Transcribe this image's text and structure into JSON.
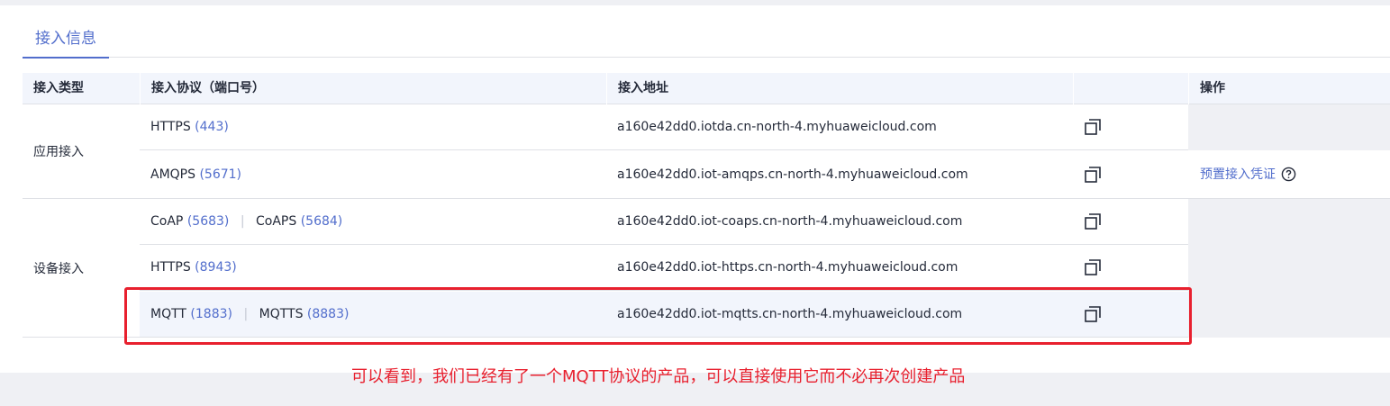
{
  "tabs": [
    {
      "label": "接入信息"
    }
  ],
  "table": {
    "headers": {
      "type": "接入类型",
      "protocol": "接入协议（端口号）",
      "address": "接入地址",
      "copy": "",
      "actions": "操作"
    },
    "groups": [
      {
        "label": "应用接入"
      },
      {
        "label": "设备接入"
      }
    ],
    "rows": [
      {
        "p1": "HTTPS",
        "port1": "(443)",
        "p2": "",
        "port2": "",
        "address": "a160e42dd0.iotda.cn-north-4.myhuaweicloud.com"
      },
      {
        "p1": "AMQPS",
        "port1": "(5671)",
        "p2": "",
        "port2": "",
        "address": "a160e42dd0.iot-amqps.cn-north-4.myhuaweicloud.com"
      },
      {
        "p1": "CoAP",
        "port1": "(5683)",
        "p2": "CoAPS",
        "port2": "(5684)",
        "address": "a160e42dd0.iot-coaps.cn-north-4.myhuaweicloud.com"
      },
      {
        "p1": "HTTPS",
        "port1": "(8943)",
        "p2": "",
        "port2": "",
        "address": "a160e42dd0.iot-https.cn-north-4.myhuaweicloud.com"
      },
      {
        "p1": "MQTT",
        "port1": "(1883)",
        "p2": "MQTTS",
        "port2": "(8883)",
        "address": "a160e42dd0.iot-mqtts.cn-north-4.myhuaweicloud.com"
      }
    ],
    "action_link": "预置接入凭证",
    "divider": "|"
  },
  "annotation": "可以看到，我们已经有了一个MQTT协议的产品，可以直接使用它而不必再次创建产品",
  "colors": {
    "accent": "#526ecc",
    "highlight": "#e8202e",
    "header_bg": "#f2f5fc"
  }
}
